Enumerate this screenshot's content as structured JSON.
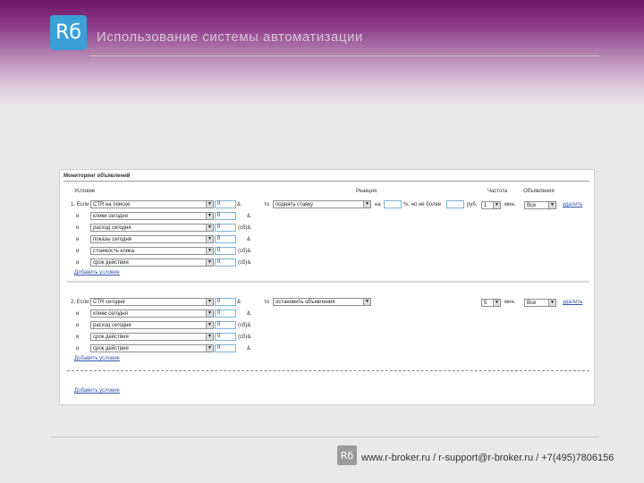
{
  "header": {
    "logo_text": "Rб",
    "title": "Использование системы автоматизации"
  },
  "footer": {
    "logo_text": "Rб",
    "contact": "www.r-broker.ru / r-support@r-broker.ru / +7(495)7806156"
  },
  "panel": {
    "title": "Мониторинг объявлений",
    "headers": {
      "condition": "Условие",
      "reaction": "Реакция",
      "frequency": "Частота",
      "ads": "Объявления"
    },
    "rule1": {
      "rows": [
        {
          "label": "1. Если",
          "field": "CTR на поиске",
          "value": "0",
          "op": "&"
        },
        {
          "label": "и",
          "field": "клики сегодня",
          "value": "0",
          "op": "&"
        },
        {
          "label": "и",
          "field": "расход сегодня",
          "value": "0",
          "op": "(сб)&"
        },
        {
          "label": "и",
          "field": "показы сегодня",
          "value": "0",
          "op": "&"
        },
        {
          "label": "и",
          "field": "стоимость клика",
          "value": "0",
          "op": "(сб)&"
        },
        {
          "label": "и",
          "field": "срок действия",
          "value": "0",
          "op": "(сб)&"
        }
      ],
      "then": "то",
      "action": "поднять ставку",
      "on": "на",
      "max_text": "%, но не более",
      "rub": "руб.",
      "freq": "1",
      "freq_unit": "мин.",
      "ads": "Все",
      "delete": "удалить",
      "add_condition": "Добавить условие"
    },
    "rule2": {
      "rows": [
        {
          "label": "2. Если",
          "field": "CTR сегодня",
          "value": "0",
          "op": "&"
        },
        {
          "label": "и",
          "field": "клики сегодня",
          "value": "0",
          "op": "&"
        },
        {
          "label": "и",
          "field": "расход сегодня",
          "value": "0",
          "op": "(сб)&"
        },
        {
          "label": "и",
          "field": "срок действия",
          "value": "0",
          "op": "(сб)&"
        },
        {
          "label": "и",
          "field": "срок действия",
          "value": "0",
          "op": "&"
        }
      ],
      "then": "то",
      "action": "остановить объявления",
      "freq": "5",
      "freq_unit": "мин.",
      "ads": "Все",
      "delete": "удалить",
      "add_condition": "Добавить условие"
    },
    "add_rule": "Добавить условие"
  }
}
